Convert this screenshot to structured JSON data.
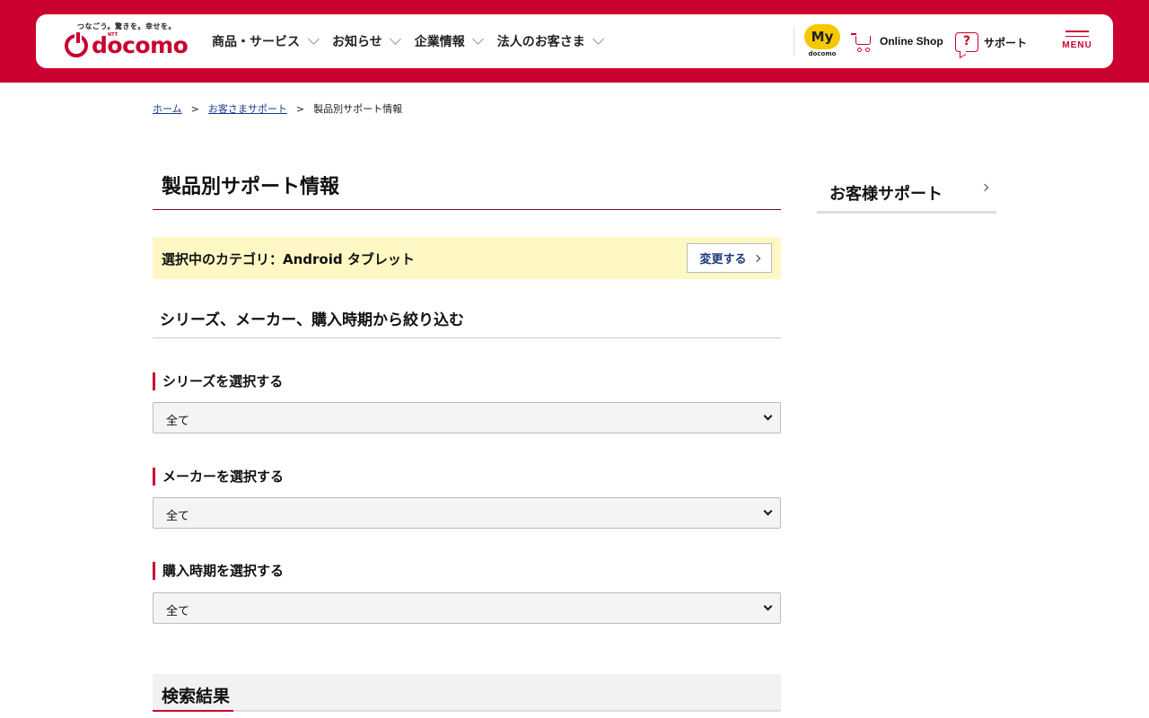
{
  "header": {
    "logo": {
      "tagline": "つなごう。驚きを。幸せを。",
      "ntt": "NTT",
      "brand": "docomo"
    },
    "nav": [
      {
        "label": "商品・サービス"
      },
      {
        "label": "お知らせ"
      },
      {
        "label": "企業情報"
      },
      {
        "label": "法人のお客さま"
      }
    ],
    "my_docomo": {
      "top": "My",
      "bottom": "docomo"
    },
    "online_shop": {
      "label": "Online Shop",
      "icon": "cart-icon"
    },
    "support": {
      "label": "サポート",
      "icon": "question-icon"
    },
    "menu": {
      "label": "MENU",
      "icon": "hamburger-icon"
    },
    "brand_color": "#c90030"
  },
  "breadcrumb": {
    "items": [
      "ホーム",
      "お客さまサポート",
      "製品別サポート情報"
    ],
    "separator": ">"
  },
  "main": {
    "title": "製品別サポート情報",
    "category": {
      "text": "選択中のカテゴリ：Android タブレット",
      "change_label": "変更する"
    },
    "filter_heading": "シリーズ、メーカー、購入時期から絞り込む",
    "filters": [
      {
        "label": "シリーズを選択する",
        "value": "全て"
      },
      {
        "label": "メーカーを選択する",
        "value": "全て"
      },
      {
        "label": "購入時期を選択する",
        "value": "全て"
      }
    ],
    "results_heading": "検索結果"
  },
  "sidebar": {
    "link_label": "お客様サポート"
  }
}
